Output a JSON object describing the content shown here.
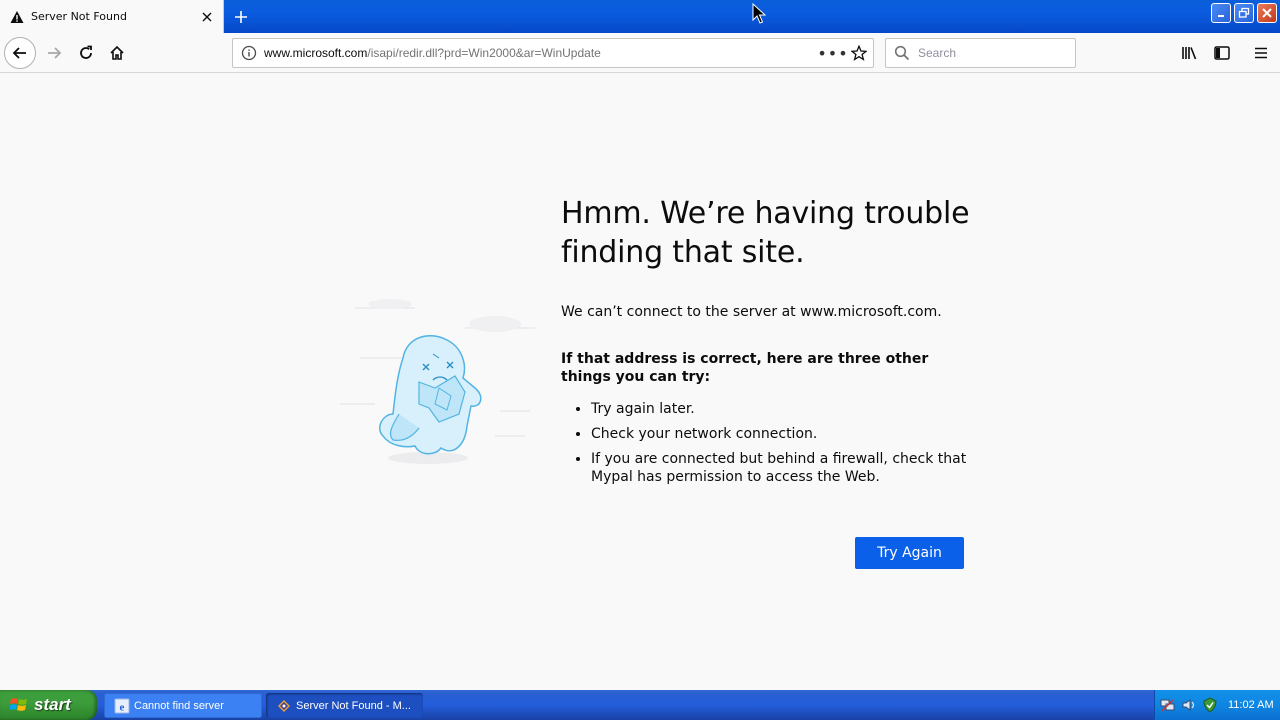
{
  "browser": {
    "tab": {
      "title": "Server Not Found",
      "icon": "warning-icon"
    },
    "url": {
      "host": "www.microsoft.com",
      "path": "/isapi/redir.dll?prd=Win2000&ar=WinUpdate"
    },
    "search": {
      "placeholder": "Search",
      "value": ""
    }
  },
  "error_page": {
    "heading": "Hmm. We’re having trouble finding that site.",
    "description": "We can’t connect to the server at www.microsoft.com.",
    "subheading": "If that address is correct, here are three other things you can try:",
    "suggestions": [
      "Try again later.",
      "Check your network connection.",
      "If you are connected but behind a firewall, check that Mypal has permission to access the Web."
    ],
    "try_again_label": "Try Again",
    "accent_color": "#0a60e8"
  },
  "taskbar": {
    "start_label": "start",
    "items": [
      {
        "label": "Cannot find server",
        "icon": "ie-icon"
      },
      {
        "label": "Server Not Found - M...",
        "icon": "mypal-icon"
      }
    ],
    "clock": "11:02 AM"
  }
}
